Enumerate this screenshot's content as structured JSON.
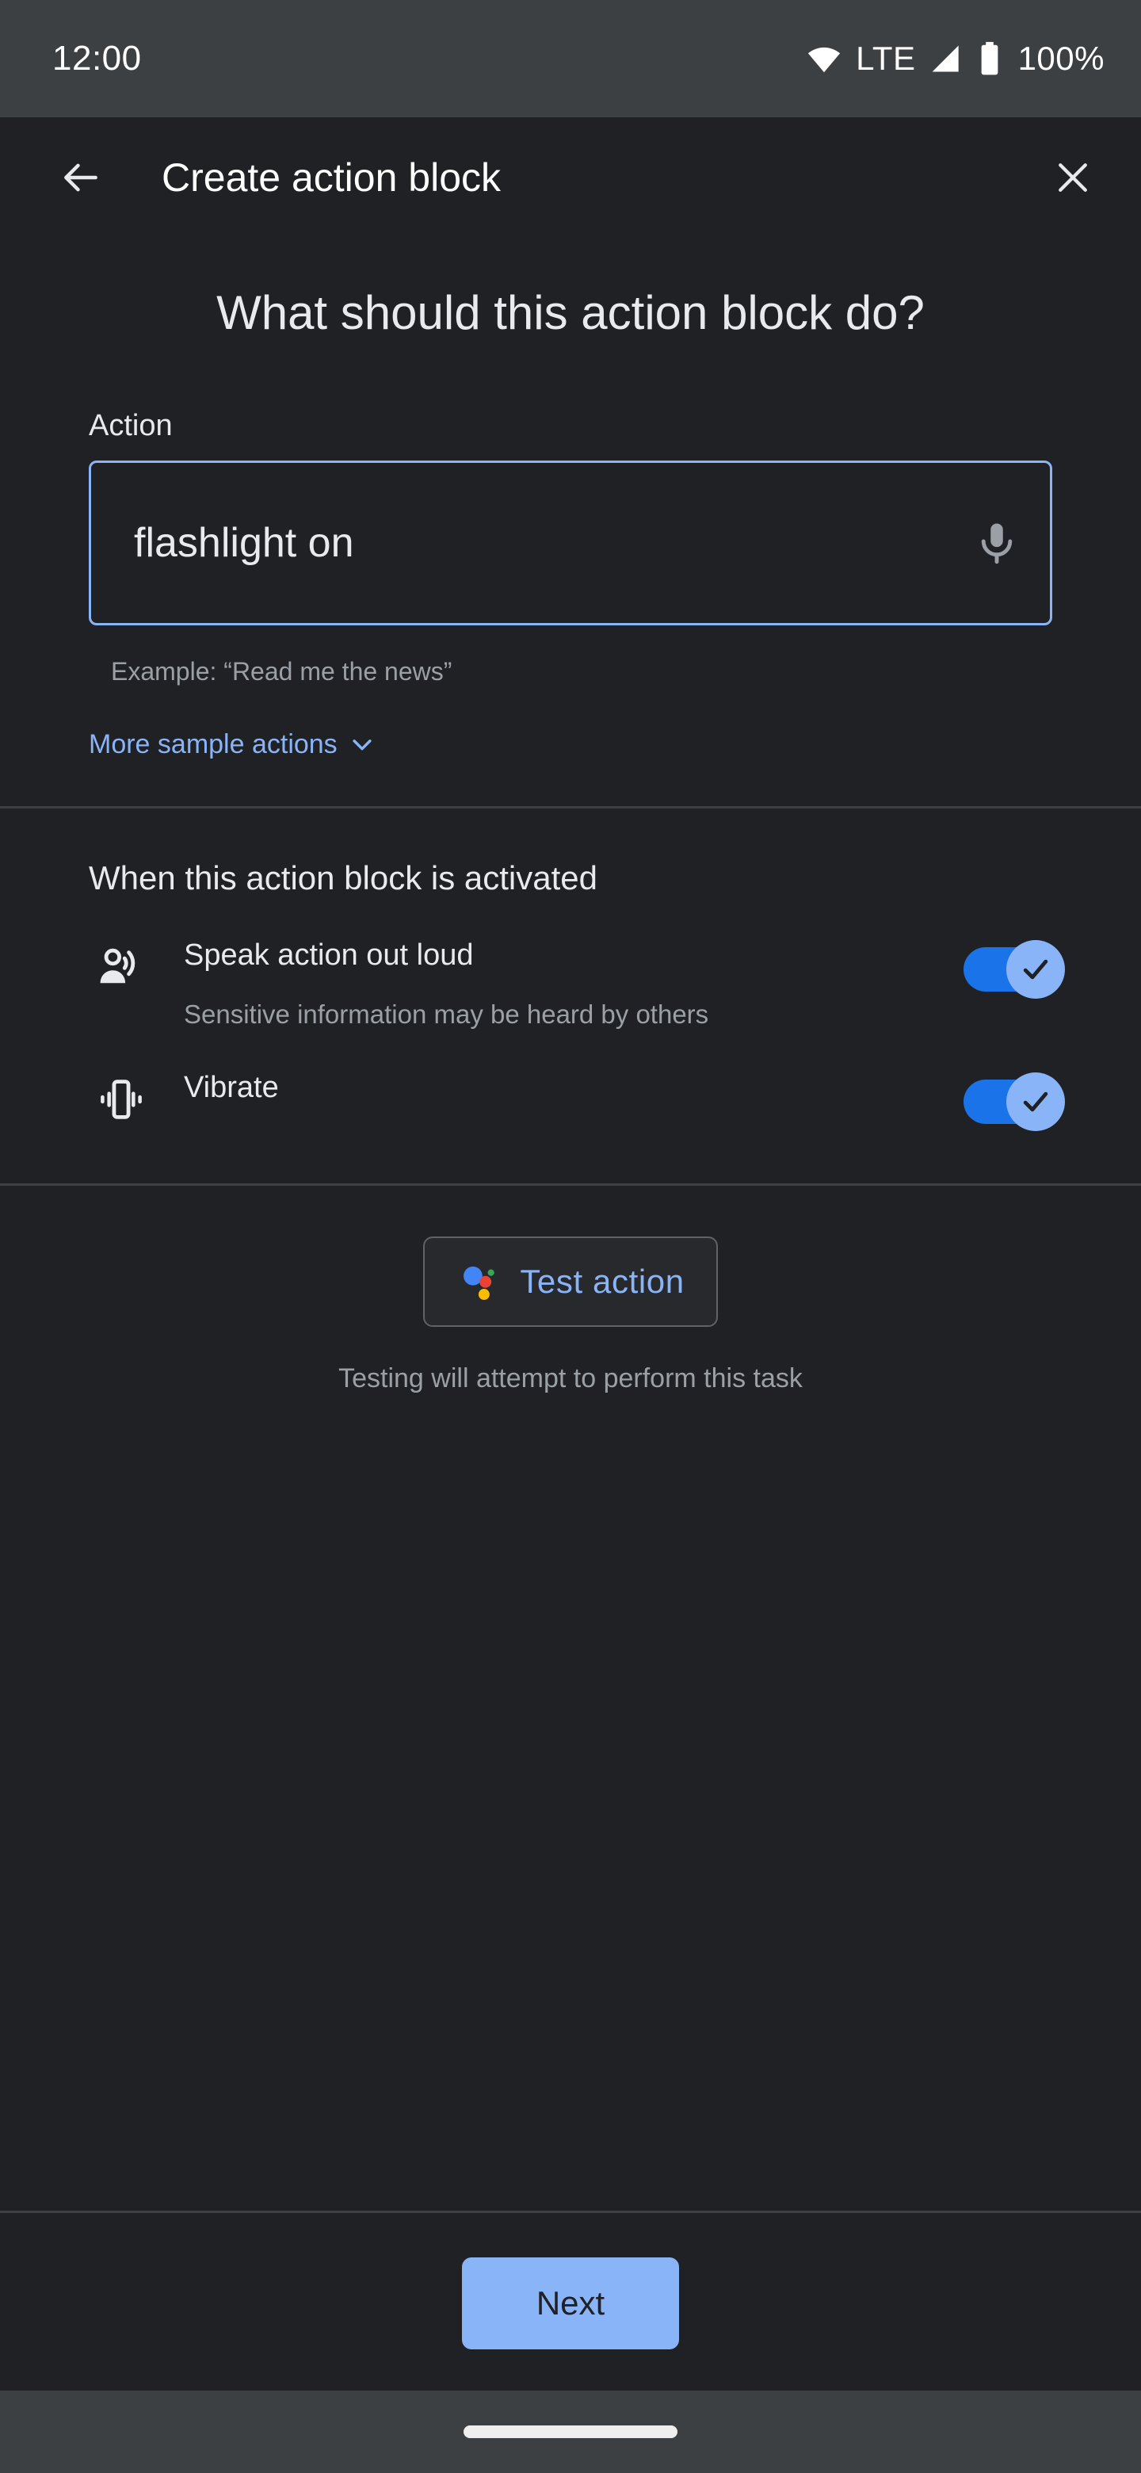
{
  "status_bar": {
    "clock": "12:00",
    "network_label": "LTE",
    "battery_label": "100%",
    "icons": [
      "wifi-icon",
      "signal-icon",
      "battery-icon"
    ],
    "background": "#3c4043"
  },
  "app_bar": {
    "back_icon": "back-arrow-icon",
    "title": "Create action block",
    "close_icon": "close-icon"
  },
  "main": {
    "headline": "What should this action block do?",
    "action_field": {
      "label": "Action",
      "value": "flashlight on",
      "placeholder": "Action",
      "mic_icon": "microphone-icon",
      "border_color": "#8ab4f8"
    },
    "hint": "Example: “Read me the news”",
    "more_samples": {
      "label": "More sample actions",
      "chevron_icon": "chevron-down-icon",
      "color": "#8ab4f8"
    },
    "activation_section": {
      "title": "When this action block is activated",
      "options": [
        {
          "icon": "person-speaking-icon",
          "label": "Speak action out loud",
          "subtitle": "Sensitive information may be heard by others",
          "toggle_on": true
        },
        {
          "icon": "vibrate-icon",
          "label": "Vibrate",
          "subtitle": "",
          "toggle_on": true
        }
      ],
      "toggle_track_color": "#1a73e8",
      "toggle_thumb_color": "#8ab4f8"
    },
    "test": {
      "icon": "google-assistant-icon",
      "label": "Test action",
      "caption": "Testing will attempt to perform this task"
    }
  },
  "bottom_bar": {
    "next_label": "Next",
    "next_bg": "#8ab4f8"
  },
  "nav_bar": {
    "gesture_pill": "gesture-pill"
  }
}
